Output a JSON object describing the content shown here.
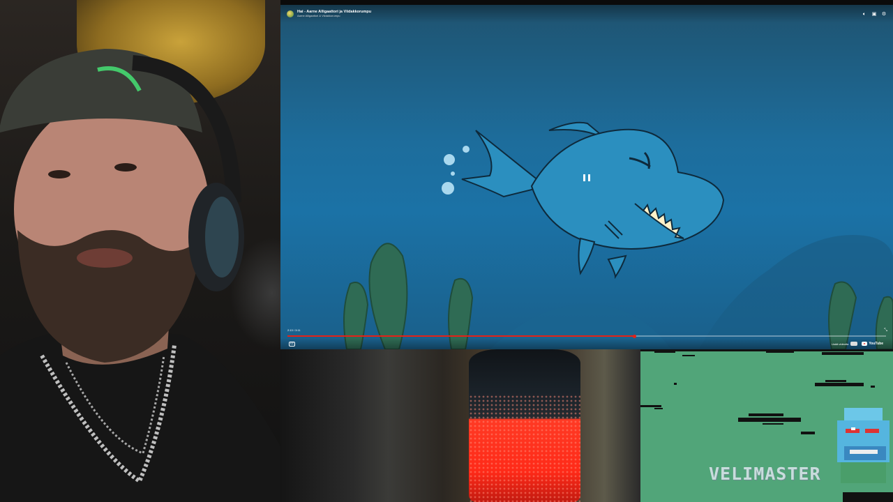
{
  "player": {
    "video_title": "Hai - Aarne Alligaattori ja Viidakkorumpu",
    "channel_name": "Aarne Alligaattori & Viidakkorumpu",
    "time_display": "2:13 / 3:11",
    "progress": 0.58,
    "watch_on_label": "Lisää videoita",
    "youtube_label": "YouTube",
    "state": "playing",
    "top_icons": [
      "volume-icon",
      "fullscreen-toggle-icon",
      "settings-icon"
    ]
  },
  "game": {
    "logo_text": "VELIMASTER"
  },
  "colors": {
    "ocean_top": "#1f5370",
    "ocean_mid": "#1b72a6",
    "shark": "#2b8fbf",
    "progress": "#e62117",
    "game_bg": "#51a579",
    "mic_red": "#ff2a18"
  }
}
